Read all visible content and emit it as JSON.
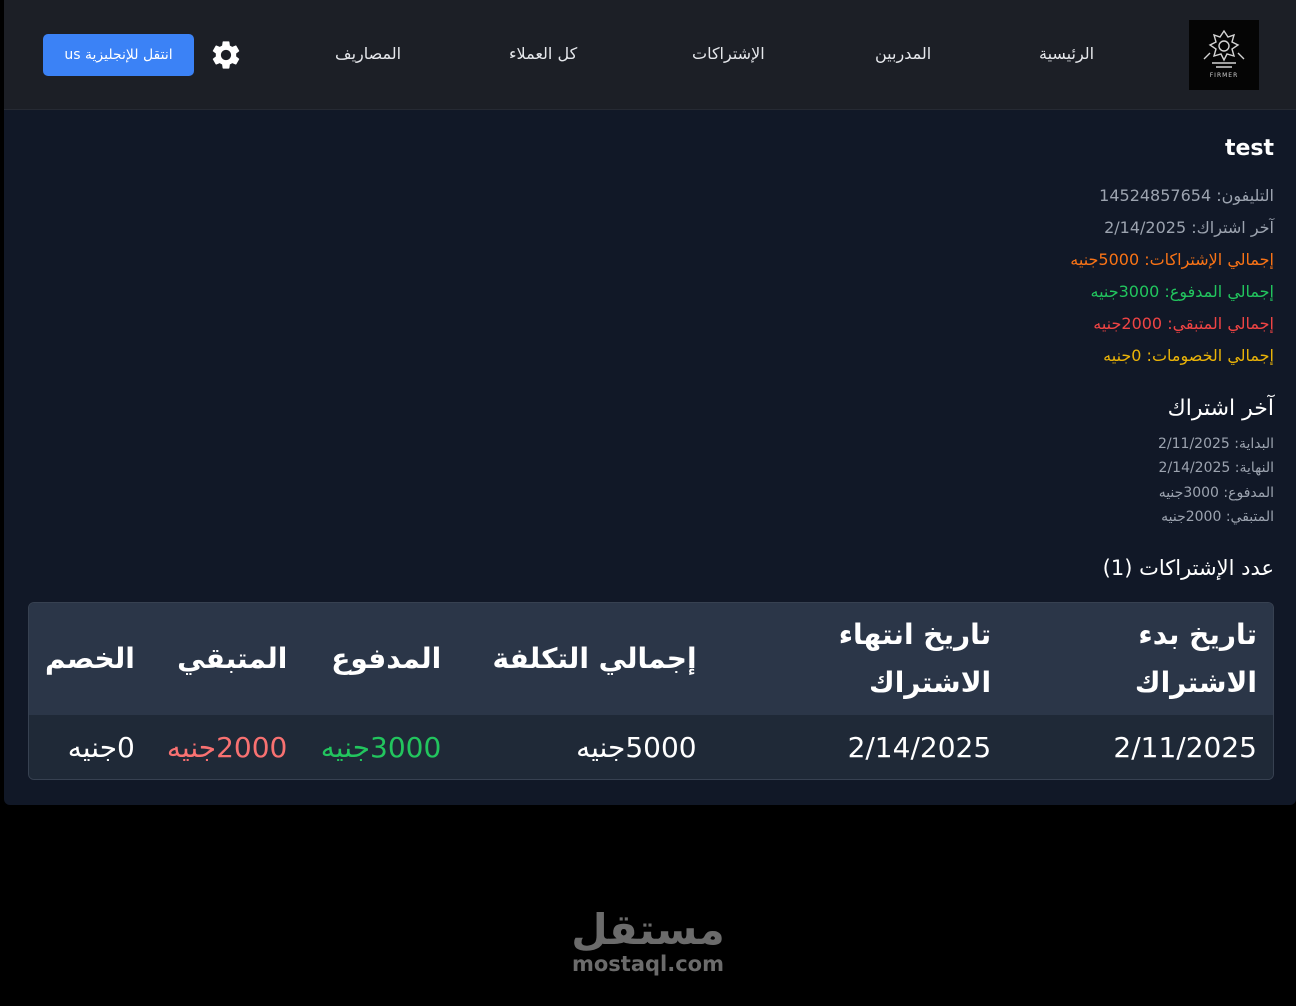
{
  "nav": {
    "logo_text": "FIRMER",
    "home": "الرئيسية",
    "trainers": "المدربين",
    "subscriptions": "الإشتراكات",
    "all_clients": "كل العملاء",
    "expenses": "المصاريف",
    "switch_language": "انتقل للإنجليزية us"
  },
  "customer": {
    "name": "test",
    "phone": "التليفون: 14524857654",
    "last_subscription": "آخر اشتراك: 2/14/2025",
    "total_subscriptions": "إجمالي الإشتراكات: 5000جنيه",
    "total_paid": "إجمالي المدفوع: 3000جنيه",
    "total_remaining": "إجمالي المتبقي: 2000جنيه",
    "total_discounts": "إجمالي الخصومات: 0جنيه"
  },
  "last_sub": {
    "heading": "آخر اشتراك",
    "start": "البداية: 2/11/2025",
    "end": "النهاية: 2/14/2025",
    "paid": "المدفوع: 3000جنيه",
    "remaining": "المتبقي: 2000جنيه"
  },
  "subs_count": "عدد الإشتراكات (1)",
  "table": {
    "headers": [
      "تاريخ بدء الاشتراك",
      "تاريخ انتهاء الاشتراك",
      "إجمالي التكلفة",
      "المدفوع",
      "المتبقي",
      "الخصم"
    ],
    "rows": [
      [
        "2/11/2025",
        "2/14/2025",
        "5000جنيه",
        "3000جنيه",
        "2000جنيه",
        "0جنيه"
      ]
    ]
  },
  "watermark": {
    "arabic": "مستقل",
    "latin": "mostaql.com"
  },
  "colors": {
    "accent": "#3b82f6",
    "orange": "#f97316",
    "green": "#22c55e",
    "red": "#ef4444",
    "yellow": "#eab308"
  }
}
